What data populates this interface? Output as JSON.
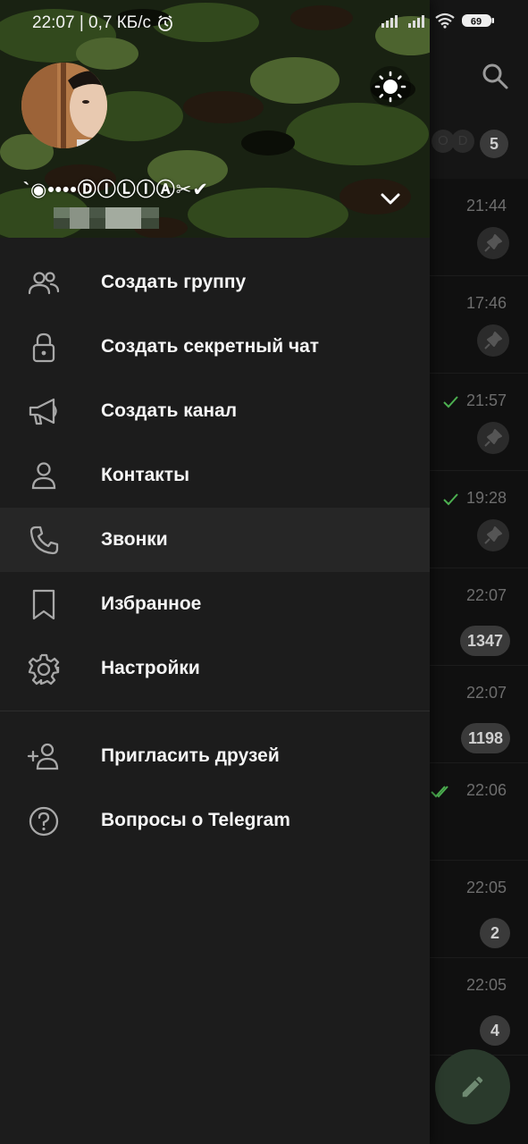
{
  "status_bar": {
    "time_speed": "22:07 | 0,7 КБ/с",
    "battery": "69"
  },
  "drawer": {
    "user_name": "`◉••••ⒹⒾⓁⒾⒶ✂✔",
    "menu": [
      {
        "label": "Создать группу",
        "icon": "group-icon"
      },
      {
        "label": "Создать секретный чат",
        "icon": "lock-icon"
      },
      {
        "label": "Создать канал",
        "icon": "megaphone-icon"
      },
      {
        "label": "Контакты",
        "icon": "person-icon"
      },
      {
        "label": "Звонки",
        "icon": "phone-icon"
      },
      {
        "label": "Избранное",
        "icon": "bookmark-icon"
      },
      {
        "label": "Настройки",
        "icon": "gear-icon"
      }
    ],
    "extra_menu": [
      {
        "label": "Пригласить друзей",
        "icon": "add-person-icon"
      },
      {
        "label": "Вопросы о Telegram",
        "icon": "help-icon"
      }
    ]
  },
  "chat_list": {
    "story_badge": "5",
    "story_letters": [
      "O",
      "D"
    ],
    "rows": [
      {
        "time": "21:44",
        "pinned": true,
        "check": "none"
      },
      {
        "time": "17:46",
        "pinned": true,
        "check": "none"
      },
      {
        "time": "21:57",
        "pinned": true,
        "check": "single"
      },
      {
        "time": "19:28",
        "pinned": true,
        "check": "single"
      },
      {
        "time": "22:07",
        "unread": "1347",
        "check": "none"
      },
      {
        "time": "22:07",
        "unread": "1198",
        "check": "none"
      },
      {
        "time": "22:06",
        "check": "double"
      },
      {
        "time": "22:05",
        "unread": "2",
        "check": "none"
      },
      {
        "time": "22:05",
        "unread": "4",
        "check": "none"
      }
    ]
  },
  "colors": {
    "drawer_bg": "#1c1c1c",
    "active_row": "#262626",
    "check_green": "#4caf50",
    "fab_bg": "#2a3a2c"
  }
}
